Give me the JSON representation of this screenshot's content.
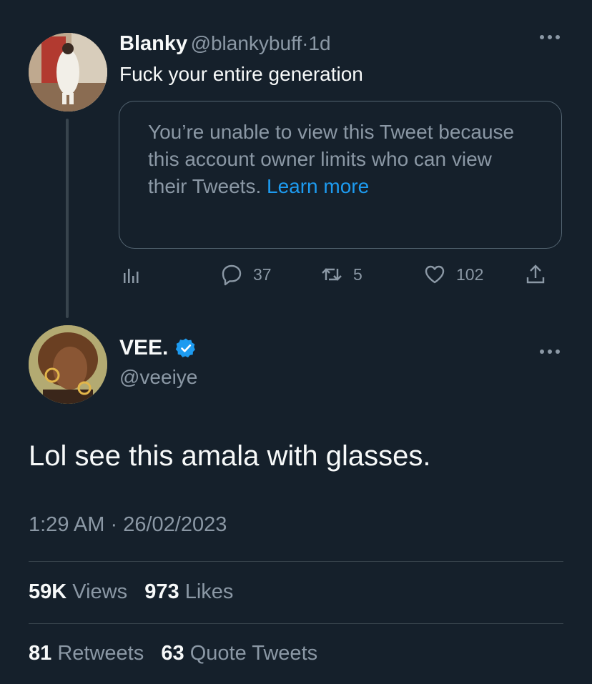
{
  "parent_tweet": {
    "author_name": "Blanky",
    "author_handle": "@blankybuff",
    "separator": "·",
    "age": "1d",
    "text": "Fuck your entire generation",
    "unavailable_notice": {
      "message": "You’re unable to view this Tweet because this account owner limits who can view their Tweets.",
      "link_text": "Learn more"
    },
    "actions": {
      "reply_count": "37",
      "retweet_count": "5",
      "like_count": "102"
    }
  },
  "reply_tweet": {
    "author_name": "VEE.",
    "verified": true,
    "author_handle": "@veeiye",
    "text": "Lol see this amala with glasses.",
    "time": "1:29 AM",
    "date": "26/02/2023",
    "stats": {
      "views_count": "59K",
      "views_label": "Views",
      "likes_count": "973",
      "likes_label": "Likes",
      "retweets_count": "81",
      "retweets_label": "Retweets",
      "quotes_count": "63",
      "quotes_label": "Quote Tweets"
    }
  },
  "icons": {
    "more": "more-icon",
    "analytics": "analytics-icon",
    "reply": "reply-icon",
    "retweet": "retweet-icon",
    "like": "like-icon",
    "share": "share-icon",
    "verified": "verified-badge-icon"
  },
  "colors": {
    "background": "#15202b",
    "text_primary": "#f7f9f9",
    "text_secondary": "#8b98a5",
    "link": "#1d9bf0",
    "border": "#38444d"
  }
}
